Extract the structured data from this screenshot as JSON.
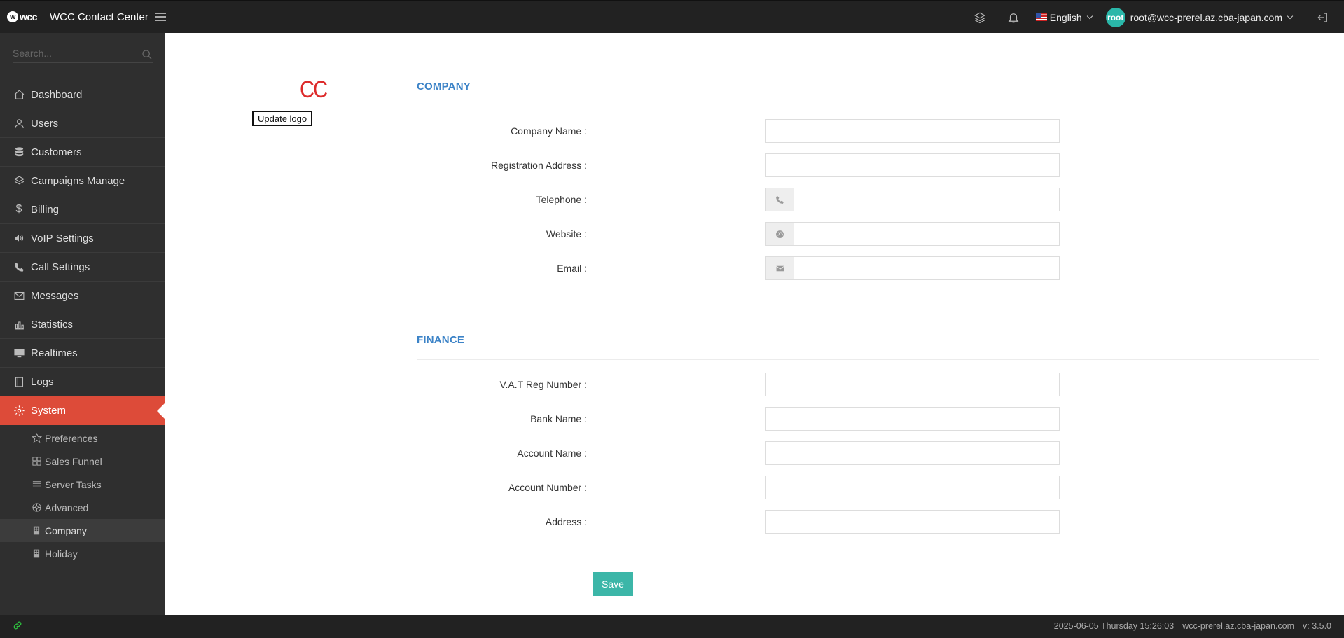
{
  "header": {
    "brand_logo": "wcc",
    "title": "WCC Contact Center",
    "language": "English",
    "user_avatar": "root",
    "user_email": "root@wcc-prerel.az.cba-japan.com"
  },
  "search": {
    "placeholder": "Search..."
  },
  "sidebar": {
    "items": [
      {
        "label": "Dashboard",
        "icon": "home-icon"
      },
      {
        "label": "Users",
        "icon": "user-icon"
      },
      {
        "label": "Customers",
        "icon": "database-icon"
      },
      {
        "label": "Campaigns Manage",
        "icon": "layers-icon"
      },
      {
        "label": "Billing",
        "icon": "dollar-icon"
      },
      {
        "label": "VoIP Settings",
        "icon": "volume-icon"
      },
      {
        "label": "Call Settings",
        "icon": "phone-icon"
      },
      {
        "label": "Messages",
        "icon": "envelope-icon"
      },
      {
        "label": "Statistics",
        "icon": "bar-chart-icon"
      },
      {
        "label": "Realtimes",
        "icon": "monitor-icon"
      },
      {
        "label": "Logs",
        "icon": "film-icon"
      },
      {
        "label": "System",
        "icon": "gear-icon",
        "active": true
      }
    ],
    "subitems": [
      {
        "label": "Preferences",
        "icon": "star-icon"
      },
      {
        "label": "Sales Funnel",
        "icon": "grid-icon"
      },
      {
        "label": "Server Tasks",
        "icon": "list-icon"
      },
      {
        "label": "Advanced",
        "icon": "aperture-icon"
      },
      {
        "label": "Company",
        "icon": "building-icon",
        "active": true
      },
      {
        "label": "Holiday",
        "icon": "building-icon"
      }
    ]
  },
  "logo": {
    "text": "CC",
    "color": "#dd2b2b",
    "update_label": "Update logo"
  },
  "company": {
    "title": "COMPANY",
    "fields": [
      {
        "label": "Company Name :",
        "value": ""
      },
      {
        "label": "Registration Address :",
        "value": ""
      },
      {
        "label": "Telephone :",
        "value": "",
        "icon": "phone-icon"
      },
      {
        "label": "Website :",
        "value": "",
        "icon": "globe-icon"
      },
      {
        "label": "Email :",
        "value": "",
        "icon": "envelope-icon"
      }
    ]
  },
  "finance": {
    "title": "FINANCE",
    "fields": [
      {
        "label": "V.A.T Reg Number :",
        "value": ""
      },
      {
        "label": "Bank Name :",
        "value": ""
      },
      {
        "label": "Account Name :",
        "value": ""
      },
      {
        "label": "Account Number :",
        "value": ""
      },
      {
        "label": "Address :",
        "value": ""
      }
    ]
  },
  "save_label": "Save",
  "footer": {
    "datetime": "2025-06-05 Thursday 15:26:03",
    "host": "wcc-prerel.az.cba-japan.com",
    "version": "v: 3.5.0"
  },
  "colors": {
    "accent": "#dd4b39",
    "teal": "#3cb6a8",
    "section_title": "#3c83c7"
  }
}
